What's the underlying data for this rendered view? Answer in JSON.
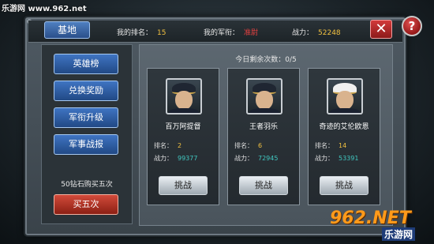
{
  "watermark": "乐游网 www.962.net",
  "header": {
    "tab": "基地",
    "rank_label": "我的排名：",
    "rank_value": "15",
    "title_label": "我的军衔：",
    "title_value": "准尉",
    "power_label": "战力：",
    "power_value": "52248",
    "close_symbol": "✕",
    "help_symbol": "?"
  },
  "menu": {
    "items": [
      {
        "label": "英雄榜"
      },
      {
        "label": "兑换奖励"
      },
      {
        "label": "军衔升级"
      },
      {
        "label": "军事战报"
      }
    ],
    "buy_note": "50钻石购买五次",
    "buy_label": "买五次"
  },
  "arena": {
    "remaining_label": "今日剩余次数：0/5",
    "rank_label": "排名：",
    "power_label": "战力：",
    "challenge_label": "挑战",
    "opponents": [
      {
        "name": "百万阿提督",
        "rank": "2",
        "power": "99377",
        "cap": "dark"
      },
      {
        "name": "王者羽乐",
        "rank": "6",
        "power": "72945",
        "cap": "dark"
      },
      {
        "name": "奇迹的艾伦欧恩",
        "rank": "14",
        "power": "53391",
        "cap": "white"
      }
    ]
  },
  "logo": {
    "main": "962.NET",
    "sub": "乐游网"
  },
  "colors": {
    "accent_blue": "#3f74c2",
    "accent_red": "#d24a3a",
    "value_gold": "#f0c040",
    "power_teal": "#40c8c0"
  }
}
